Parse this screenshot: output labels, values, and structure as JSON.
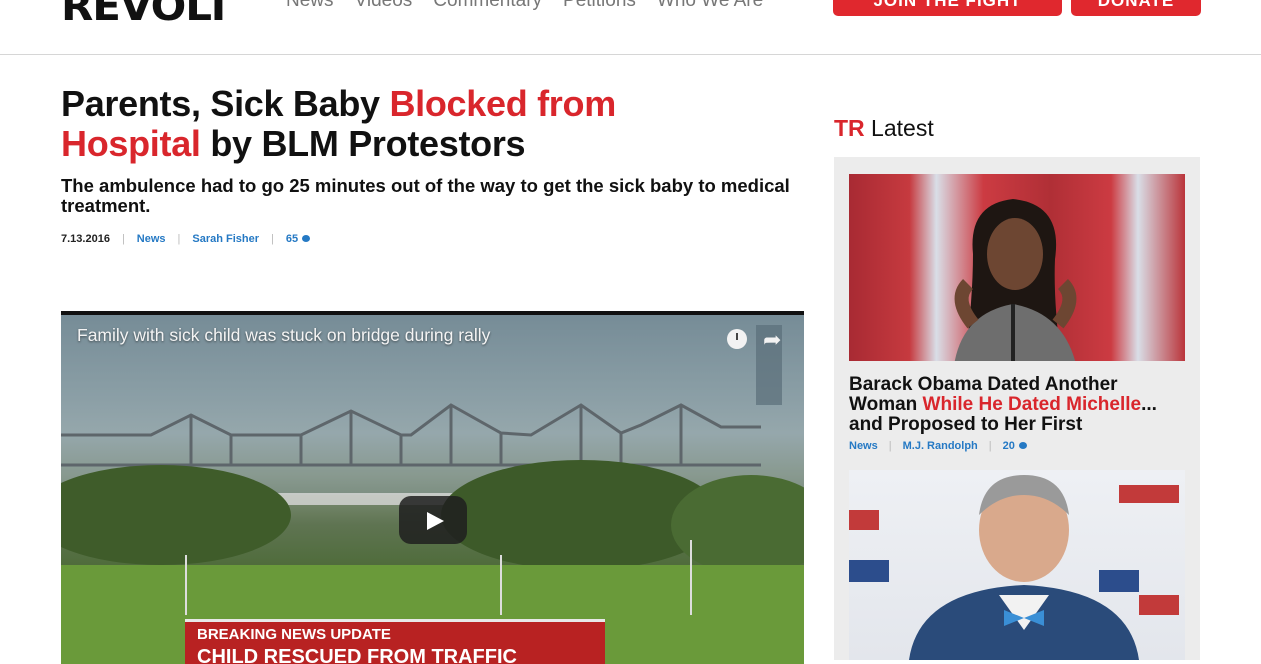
{
  "header": {
    "logo": "REVOLT",
    "nav": [
      "News",
      "Videos",
      "Commentary",
      "Petitions",
      "Who We Are"
    ],
    "join_button": "JOIN THE FIGHT",
    "donate_button": "DONATE"
  },
  "article": {
    "title_part1": "Parents, Sick Baby ",
    "title_highlight": "Blocked from Hospital",
    "title_part2": " by BLM Protestors",
    "subtitle": "The ambulence had to go 25 minutes out of the way to get the sick baby to medical treatment.",
    "date": "7.13.2016",
    "category": "News",
    "author": "Sarah Fisher",
    "comments": "65"
  },
  "video": {
    "title": "Family with sick child was stuck on bridge during rally",
    "banner_line1": "BREAKING NEWS UPDATE",
    "banner_line2": "CHILD RESCUED FROM TRAFFIC"
  },
  "sidebar": {
    "heading_brand": "TR",
    "heading_text": " Latest",
    "cards": [
      {
        "title_part1": "Barack Obama Dated Another Woman ",
        "title_highlight": "While He Dated Michelle",
        "title_part2": "... and Proposed to Her First",
        "category": "News",
        "author": "M.J. Randolph",
        "comments": "20"
      }
    ]
  },
  "colors": {
    "accent": "#d9262c",
    "link": "#2579c4"
  }
}
